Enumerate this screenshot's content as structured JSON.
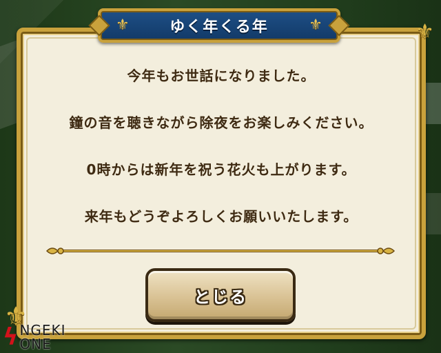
{
  "dialog": {
    "title": "ゆく年くる年",
    "message_lines": [
      "今年もお世話になりました。",
      "鐘の音を聴きながら除夜をお楽しみください。",
      "0時からは新年を祝う花火も上がります。",
      "来年もどうぞよろしくお願いいたします。"
    ],
    "close_label": "とじる"
  },
  "watermark": {
    "line1": "NGEKI",
    "line2": "ONE"
  },
  "colors": {
    "frame_gold": "#c9a23c",
    "banner_blue": "#1e4f86",
    "parchment": "#f3eedd",
    "text_brown": "#3e2a12",
    "watermark_red": "#d3121b"
  },
  "icons": {
    "title_left": "fleur-de-lis-icon",
    "title_right": "fleur-de-lis-icon",
    "corner_top_right": "fleur-de-lis-icon",
    "corner_bottom_left": "fleur-de-lis-icon",
    "watermark_mark": "lightning-bolt-icon"
  }
}
